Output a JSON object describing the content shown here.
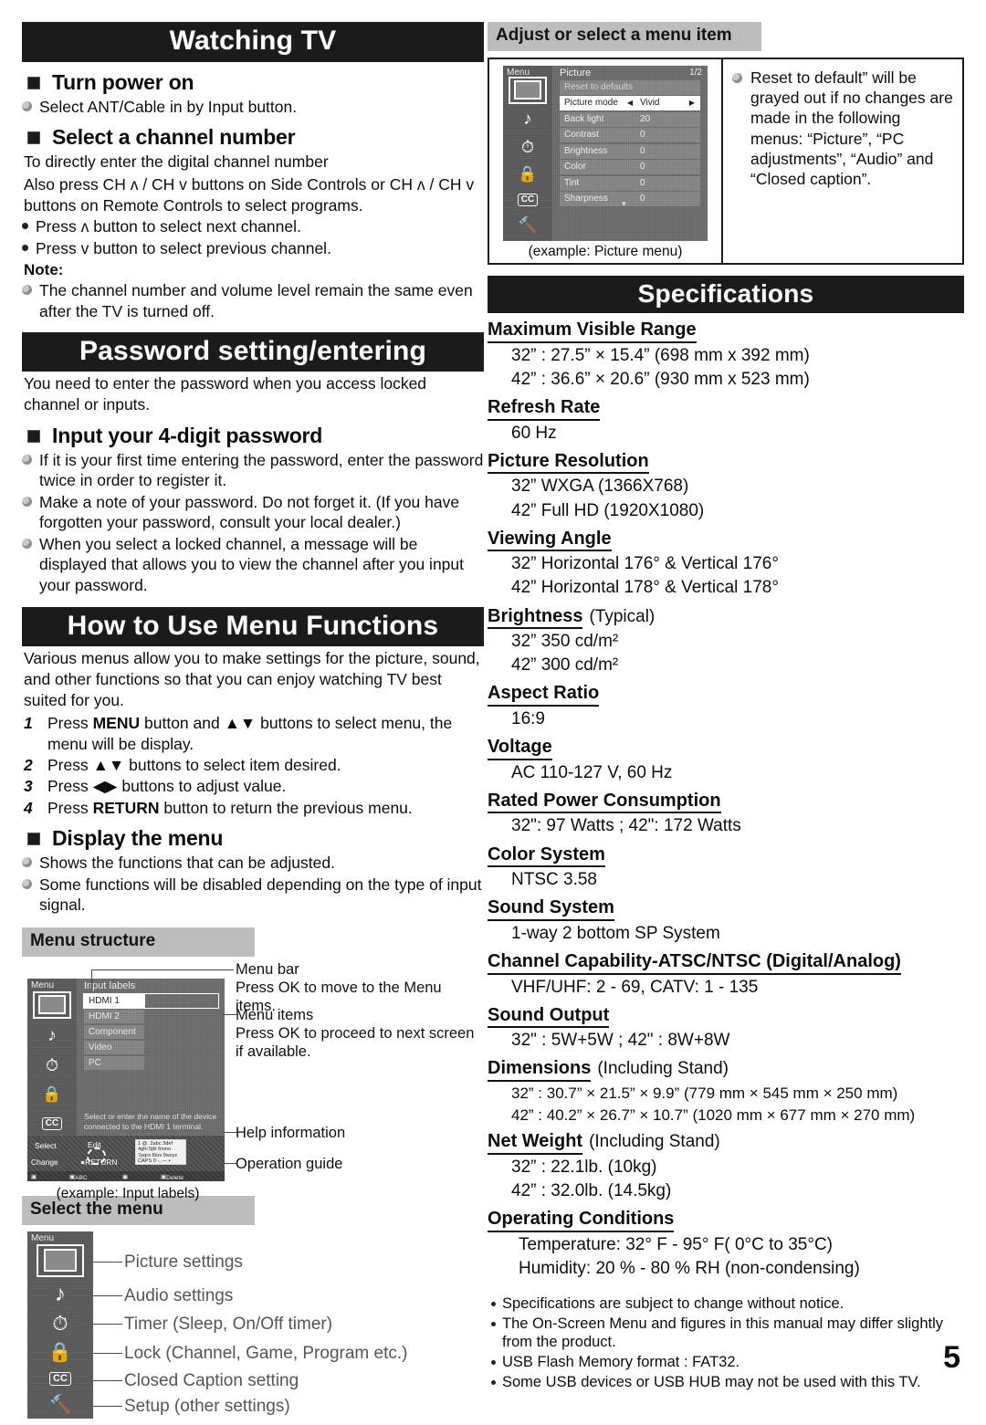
{
  "page_number": "5",
  "left_column": {
    "watching_tv": {
      "banner": "Watching TV",
      "turn_power_on": {
        "heading": "Turn power on",
        "bullets": [
          "Select ANT/Cable in by Input button."
        ]
      },
      "select_channel": {
        "heading": "Select a channel number",
        "paragraphs": [
          "To directly enter the digital channel number",
          "Also press CH ʌ / CH ᴠ buttons on Side Controls or CH ʌ / CH ᴠ buttons on Remote Controls to select programs."
        ],
        "dot_bullets": [
          "Press ʌ button to select next channel.",
          "Press ᴠ button to select previous channel."
        ],
        "note_label": "Note:",
        "note_bullets": [
          "The channel number and volume level remain the same even after the TV is turned off."
        ]
      }
    },
    "password": {
      "banner": "Password setting/entering",
      "intro": "You need to enter the password when you access locked channel or inputs.",
      "heading": "Input your 4-digit password",
      "bullets": [
        "If it is your first time entering the password, enter the password twice in order to register it.",
        "Make a note of your password. Do not forget it. (If you have forgotten your password, consult your local dealer.)",
        "When you select a locked channel, a message will be displayed that allows you to view the channel after you input your password."
      ]
    },
    "menu_functions": {
      "banner": "How to Use Menu Functions",
      "intro": "Various menus allow you to make settings for the picture, sound, and other functions so that you can enjoy watching TV best suited for you.",
      "steps": [
        {
          "num": "1",
          "text_pre": "Press ",
          "bold": "MENU",
          "text_post": " button and ▲▼ buttons to select menu, the menu will be display."
        },
        {
          "num": "2",
          "text_pre": "Press ▲▼ buttons to select item desired.",
          "bold": "",
          "text_post": ""
        },
        {
          "num": "3",
          "text_pre": "Press ◀▶ buttons to adjust value.",
          "bold": "",
          "text_post": ""
        },
        {
          "num": "4",
          "text_pre": "Press ",
          "bold": "RETURN",
          "text_post": " button to return the previous menu."
        }
      ],
      "display_menu": {
        "heading": "Display the menu",
        "bullets": [
          "Shows the functions that can be adjusted.",
          "Some functions will be disabled depending on the type of input signal."
        ]
      }
    },
    "menu_structure": {
      "subhead": "Menu structure",
      "osd": {
        "menu_word": "Menu",
        "title": "Input labels",
        "rows": [
          "HDMI 1",
          "HDMI 2",
          "Component",
          "Video",
          "PC"
        ],
        "help_text": "Select or enter the name of the device connected to the HDMI 1 terminal.",
        "guide": {
          "select": "Select",
          "change": "Change",
          "edit": "Edit",
          "return": "RETURN",
          "keypad": [
            "1 @. 2abc 3def",
            "4ghi 5jkl 6mno",
            "7pqrs 8tuv 9wxyz",
            "CAPS 0 -, — •"
          ],
          "bottom": [
            "ABC → abc",
            "Delete"
          ]
        }
      },
      "caption": "(example: Input labels)",
      "annotations": [
        {
          "title": "Menu bar",
          "desc": "Press OK to move to the Menu items."
        },
        {
          "title": "Menu items",
          "desc": "Press OK to proceed to next screen if available."
        },
        {
          "title": "Help information",
          "desc": ""
        },
        {
          "title": "Operation guide",
          "desc": ""
        }
      ]
    },
    "select_menu": {
      "subhead": "Select the menu",
      "menu_word": "Menu",
      "items": [
        {
          "icon": "picture-icon",
          "label": "Picture settings"
        },
        {
          "icon": "music-note-icon",
          "label": "Audio settings"
        },
        {
          "icon": "timer-icon",
          "label": "Timer (Sleep, On/Off timer)"
        },
        {
          "icon": "lock-icon",
          "label": "Lock (Channel, Game, Program etc.)"
        },
        {
          "icon": "closed-caption-icon",
          "label": "Closed Caption setting"
        },
        {
          "icon": "setup-icon",
          "label": "Setup (other settings)"
        }
      ]
    }
  },
  "right_column": {
    "adjust_item": {
      "subhead": "Adjust or select a menu item",
      "osd": {
        "menu_word": "Menu",
        "title": "Picture",
        "page": "1/2",
        "rows": [
          {
            "label": "Reset to defaults",
            "value": "",
            "state": "grey"
          },
          {
            "label": "Picture mode",
            "value": "Vivid",
            "state": "highlight",
            "arrows": true
          },
          {
            "label": "Back light",
            "value": "20",
            "state": "normal"
          },
          {
            "label": "Contrast",
            "value": "0",
            "state": "normal"
          },
          {
            "label": "Brightness",
            "value": "0",
            "state": "normal"
          },
          {
            "label": "Color",
            "value": "0",
            "state": "normal"
          },
          {
            "label": "Tint",
            "value": "0",
            "state": "normal"
          },
          {
            "label": "Sharpness",
            "value": "0",
            "state": "normal"
          }
        ],
        "more_indicator": "▾"
      },
      "caption": "(example:  Picture menu)",
      "note": "Reset to default” will be grayed out if no changes are made in the following menus: “Picture”, “PC adjustments”, “Audio” and “Closed caption”."
    },
    "specifications": {
      "banner": "Specifications",
      "entries": [
        {
          "heading": "Maximum Visible Range",
          "suffix": "",
          "values": [
            "32” : 27.5” × 15.4” (698 mm x 392 mm)",
            "42” : 36.6” × 20.6” (930 mm x 523 mm)"
          ]
        },
        {
          "heading": "Refresh Rate",
          "suffix": "",
          "values": [
            "60 Hz"
          ]
        },
        {
          "heading": "Picture Resolution",
          "suffix": "",
          "values": [
            "32” WXGA (1366X768)",
            "42” Full HD (1920X1080)"
          ]
        },
        {
          "heading": "Viewing Angle",
          "suffix": "",
          "values": [
            "32” Horizontal 176° & Vertical 176°",
            "42” Horizontal 178° & Vertical 178°"
          ]
        },
        {
          "heading": "Brightness",
          "suffix": "(Typical)",
          "values": [
            "32” 350 cd/m²",
            "42” 300 cd/m²"
          ]
        },
        {
          "heading": "Aspect Ratio",
          "suffix": "",
          "values": [
            "16:9"
          ]
        },
        {
          "heading": "Voltage",
          "suffix": "",
          "values": [
            "AC 110-127 V, 60 Hz"
          ]
        },
        {
          "heading": "Rated Power Consumption",
          "suffix": "",
          "values": [
            "32\": 97 Watts ; 42\": 172 Watts"
          ]
        },
        {
          "heading": "Color System",
          "suffix": "",
          "values": [
            "NTSC 3.58"
          ]
        },
        {
          "heading": "Sound System",
          "suffix": "",
          "values": [
            "1-way 2 bottom SP System"
          ]
        },
        {
          "heading": "Channel Capability-ATSC/NTSC (Digital/Analog)",
          "suffix": "",
          "values": [
            "VHF/UHF: 2 - 69, CATV: 1 - 135"
          ]
        },
        {
          "heading": "Sound Output",
          "suffix": "",
          "values": [
            "32\" : 5W+5W ; 42\" : 8W+8W"
          ]
        },
        {
          "heading": "Dimensions",
          "suffix": "(Including Stand)",
          "values": [
            "32” : 30.7” × 21.5” × 9.9” (779 mm × 545 mm × 250 mm)",
            "42” : 40.2” × 26.7” × 10.7” (1020 mm × 677 mm × 270 mm)"
          ]
        },
        {
          "heading": "Net Weight",
          "suffix": "(Including Stand)",
          "values": [
            "32” : 22.1lb. (10kg)",
            "42” : 32.0lb. (14.5kg)"
          ]
        },
        {
          "heading": "Operating Conditions",
          "suffix": "",
          "values": [
            "Temperature: 32° F - 95° F( 0°C to 35°C)",
            "Humidity: 20 % - 80 % RH (non-condensing)"
          ]
        }
      ],
      "footnotes": [
        "Specifications are subject to change without notice.",
        "The On-Screen Menu and figures in this manual may differ slightly from the product.",
        "USB Flash Memory format : FAT32.",
        "Some USB devices or USB HUB may not be used with this TV."
      ]
    }
  }
}
